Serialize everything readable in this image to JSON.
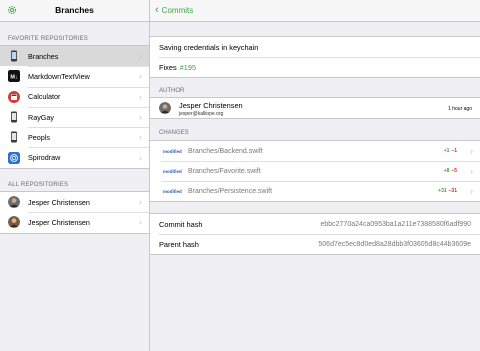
{
  "sidebar": {
    "title": "Branches",
    "favorites_header": "FAVORITE REPOSITORIES",
    "favorites": [
      {
        "label": "Branches",
        "icon": "phone-icon",
        "selected": true
      },
      {
        "label": "MarkdownTextView",
        "icon": "markdown-icon",
        "selected": false
      },
      {
        "label": "Calculator",
        "icon": "calculator-icon",
        "selected": false
      },
      {
        "label": "RayGay",
        "icon": "phone-icon",
        "selected": false
      },
      {
        "label": "Peopls",
        "icon": "phone-icon",
        "selected": false
      },
      {
        "label": "Spirodraw",
        "icon": "spiro-icon",
        "selected": false
      }
    ],
    "all_header": "ALL REPOSITORIES",
    "all": [
      {
        "label": "Jesper Christensen",
        "icon": "avatar"
      },
      {
        "label": "Jesper Christensen",
        "icon": "avatar"
      }
    ]
  },
  "detail": {
    "back_label": "Commits",
    "message": {
      "line1": "Saving credentials in keychain",
      "fixes_prefix": "Fixes",
      "fixes_ref": "#195"
    },
    "author_header": "AUTHOR",
    "author": {
      "name": "Jesper Christensen",
      "email": "jesper@kalliope.org",
      "time": "1 hour ago"
    },
    "changes_header": "CHANGES",
    "changes": [
      {
        "status": "modified",
        "file": "Branches/Backend.swift",
        "add": "+1",
        "del": "–1"
      },
      {
        "status": "modified",
        "file": "Branches/Favorite.swift",
        "add": "+8",
        "del": "–5"
      },
      {
        "status": "modified",
        "file": "Branches/Persistence.swift",
        "add": "+31",
        "del": "–31"
      }
    ],
    "hashes": {
      "commit_label": "Commit hash",
      "commit_value": "ebbc2770a24ca0953ba1a211e7388580f6adf990",
      "parent_label": "Parent hash",
      "parent_value": "506d7ec5ec8d0ed8a28dbb3f03605d8c44b3609e"
    }
  },
  "colors": {
    "accent": "#41a247",
    "modified": "#2c5ba8",
    "deletion": "#d0312d"
  }
}
